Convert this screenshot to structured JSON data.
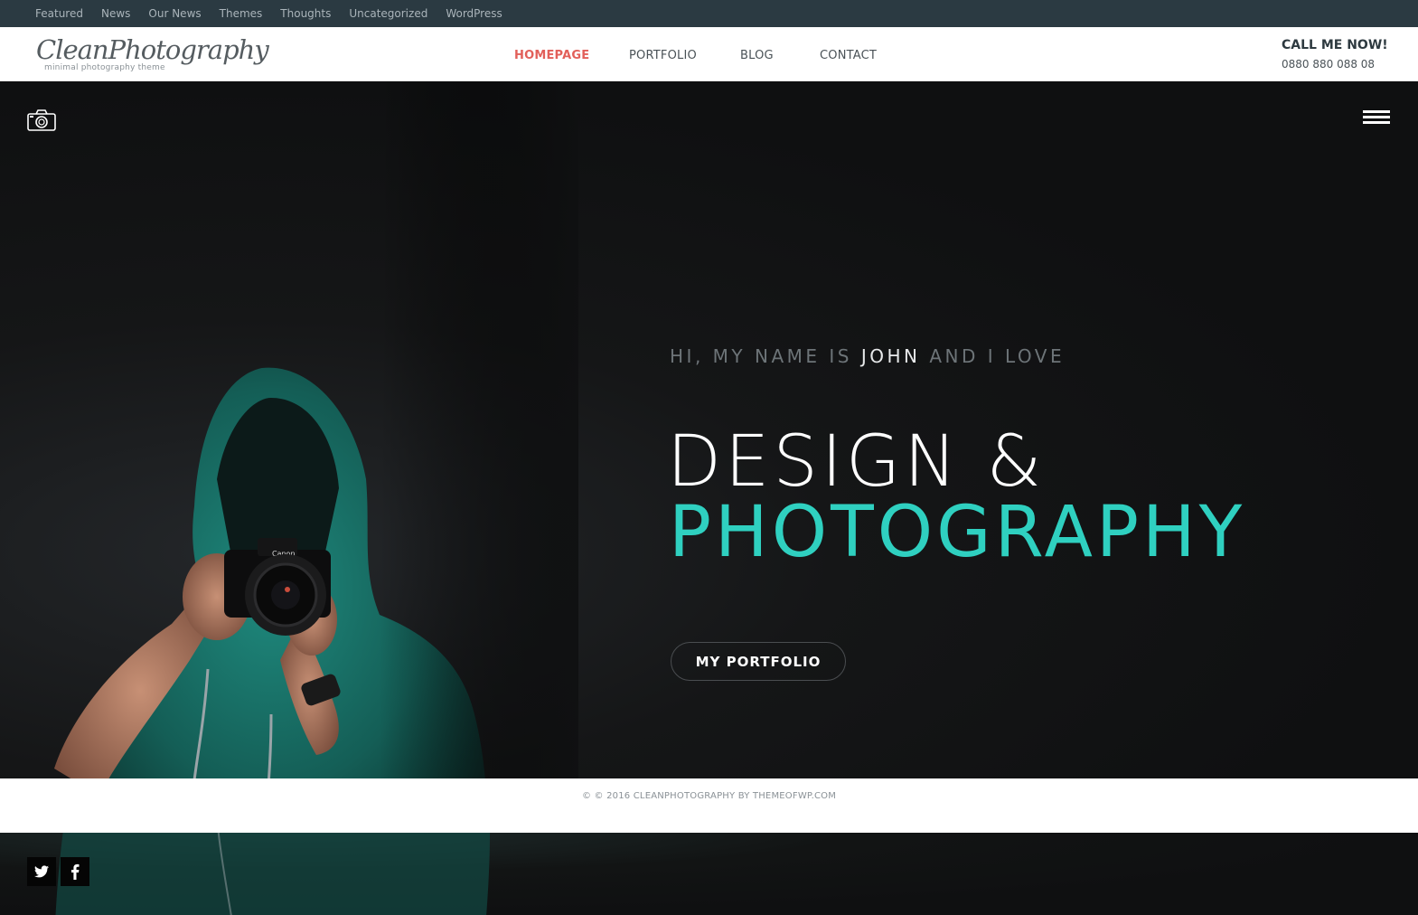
{
  "topbar": {
    "links": [
      "Featured",
      "News",
      "Our News",
      "Themes",
      "Thoughts",
      "Uncategorized",
      "WordPress"
    ]
  },
  "header": {
    "logo_text": "CleanPhotography",
    "logo_tagline": "minimal photography theme",
    "nav": [
      "HOMEPAGE",
      "PORTFOLIO",
      "BLOG",
      "CONTACT"
    ],
    "active_nav": "HOMEPAGE",
    "call_title": "CALL ME NOW!",
    "call_number": "0880 880 088 08"
  },
  "hero": {
    "intro_prefix": "HI, MY NAME IS ",
    "intro_name": "JOHN",
    "intro_suffix": " AND I LOVE",
    "headline_line1": "DESIGN &",
    "headline_line2": "PHOTOGRAPHY",
    "button_label": "MY PORTFOLIO",
    "icons": [
      "camera-icon",
      "hamburger-menu-icon"
    ]
  },
  "footer": {
    "copyright": "© © 2016 CLEANPHOTOGRAPHY BY THEMEOFWP.COM"
  },
  "social": [
    "twitter-icon",
    "facebook-icon"
  ],
  "colors": {
    "topbar_bg": "#2b3a42",
    "accent_nav": "#e2605a",
    "accent_teal": "#2fd0c0",
    "hero_bg": "#111213"
  }
}
